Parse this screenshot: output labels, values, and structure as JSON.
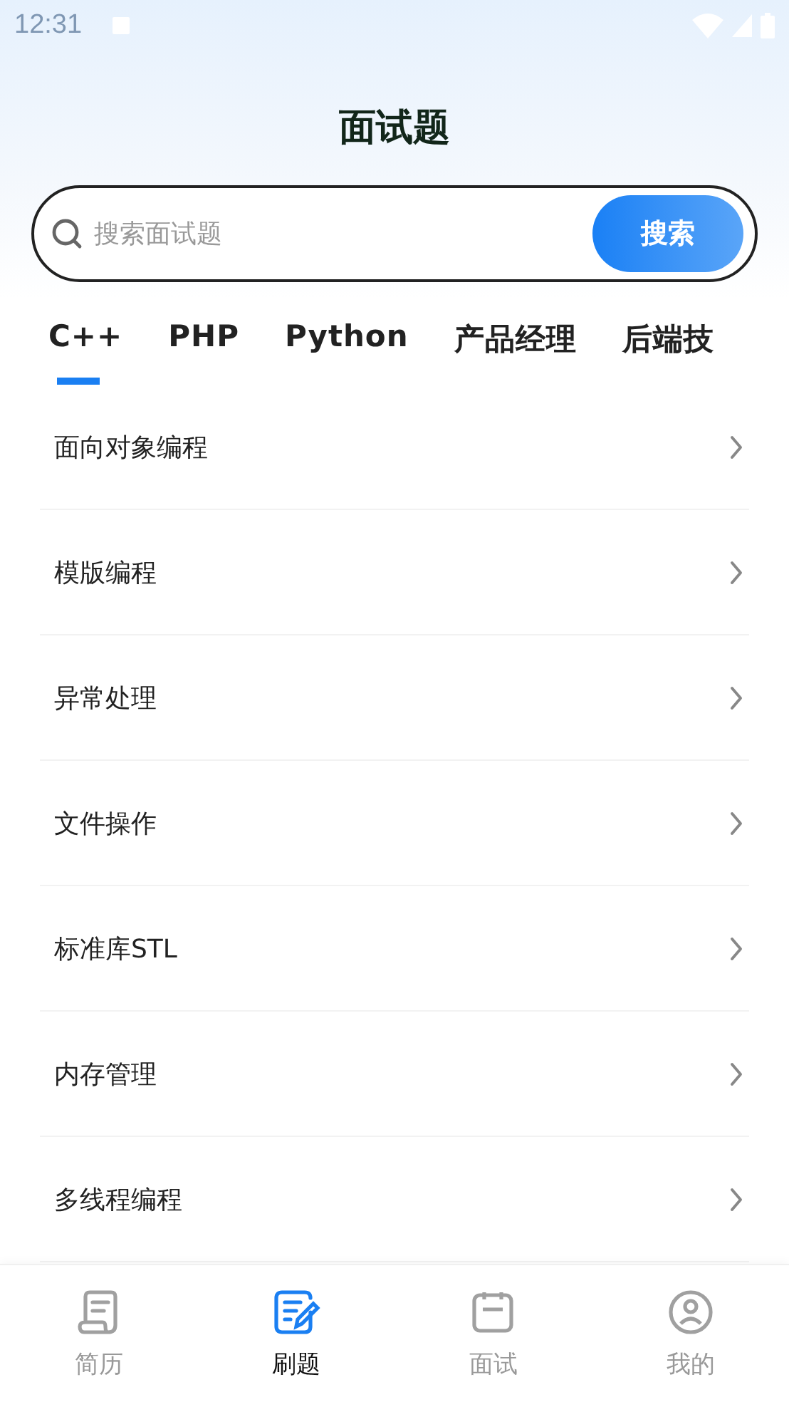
{
  "status_bar": {
    "time": "12:31"
  },
  "header": {
    "title": "面试题"
  },
  "search": {
    "placeholder": "搜索面试题",
    "button": "搜索"
  },
  "tabs": [
    {
      "label": "C++",
      "selected": true
    },
    {
      "label": "PHP",
      "selected": false
    },
    {
      "label": "Python",
      "selected": false
    },
    {
      "label": "产品经理",
      "selected": false
    },
    {
      "label": "后端技",
      "selected": false
    }
  ],
  "list": [
    {
      "label": "面向对象编程"
    },
    {
      "label": "模版编程"
    },
    {
      "label": "异常处理"
    },
    {
      "label": "文件操作"
    },
    {
      "label": "标准库STL"
    },
    {
      "label": "内存管理"
    },
    {
      "label": "多线程编程"
    }
  ],
  "bottom_nav": [
    {
      "kind": "resume",
      "label": "简历",
      "selected": false
    },
    {
      "kind": "practice",
      "label": "刷题",
      "selected": true
    },
    {
      "kind": "interview",
      "label": "面试",
      "selected": false
    },
    {
      "kind": "profile",
      "label": "我的",
      "selected": false
    }
  ]
}
